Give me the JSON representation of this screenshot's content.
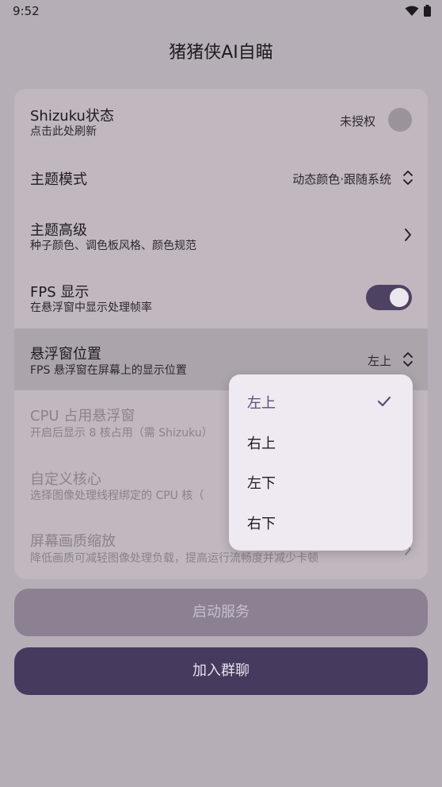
{
  "status_bar": {
    "time": "9:52",
    "icons": [
      "wifi-icon",
      "battery-icon"
    ]
  },
  "app": {
    "title": "猪猪侠AI自瞄"
  },
  "settings": {
    "shizuku": {
      "title": "Shizuku状态",
      "subtitle": "点击此处刷新",
      "value": "未授权"
    },
    "theme_mode": {
      "title": "主题模式",
      "value": "动态颜色·跟随系统"
    },
    "theme_advanced": {
      "title": "主题高级",
      "subtitle": "种子颜色、调色板风格、颜色规范"
    },
    "fps": {
      "title": "FPS 显示",
      "subtitle": "在悬浮窗中显示处理帧率",
      "enabled": true
    },
    "overlay_position": {
      "title": "悬浮窗位置",
      "subtitle": "FPS 悬浮窗在屏幕上的显示位置",
      "value": "左上"
    },
    "cpu_overlay": {
      "title": "CPU 占用悬浮窗",
      "subtitle": "开启后显示 8 核占用（需 Shizuku）"
    },
    "custom_core": {
      "title": "自定义核心",
      "subtitle": "选择图像处理线程绑定的 CPU 核（"
    },
    "screen_scale": {
      "title": "屏幕画质缩放",
      "subtitle": "降低画质可减轻图像处理负载，提高运行流畅度并减少卡顿"
    }
  },
  "buttons": {
    "start_service": "启动服务",
    "join_group": "加入群聊"
  },
  "dropdown": {
    "selected": "左上",
    "options": [
      "左上",
      "右上",
      "左下",
      "右下"
    ]
  },
  "colors": {
    "accent": "#4e4263",
    "scrim_background": "#b6aeb6",
    "menu_background": "#efe9f1"
  }
}
